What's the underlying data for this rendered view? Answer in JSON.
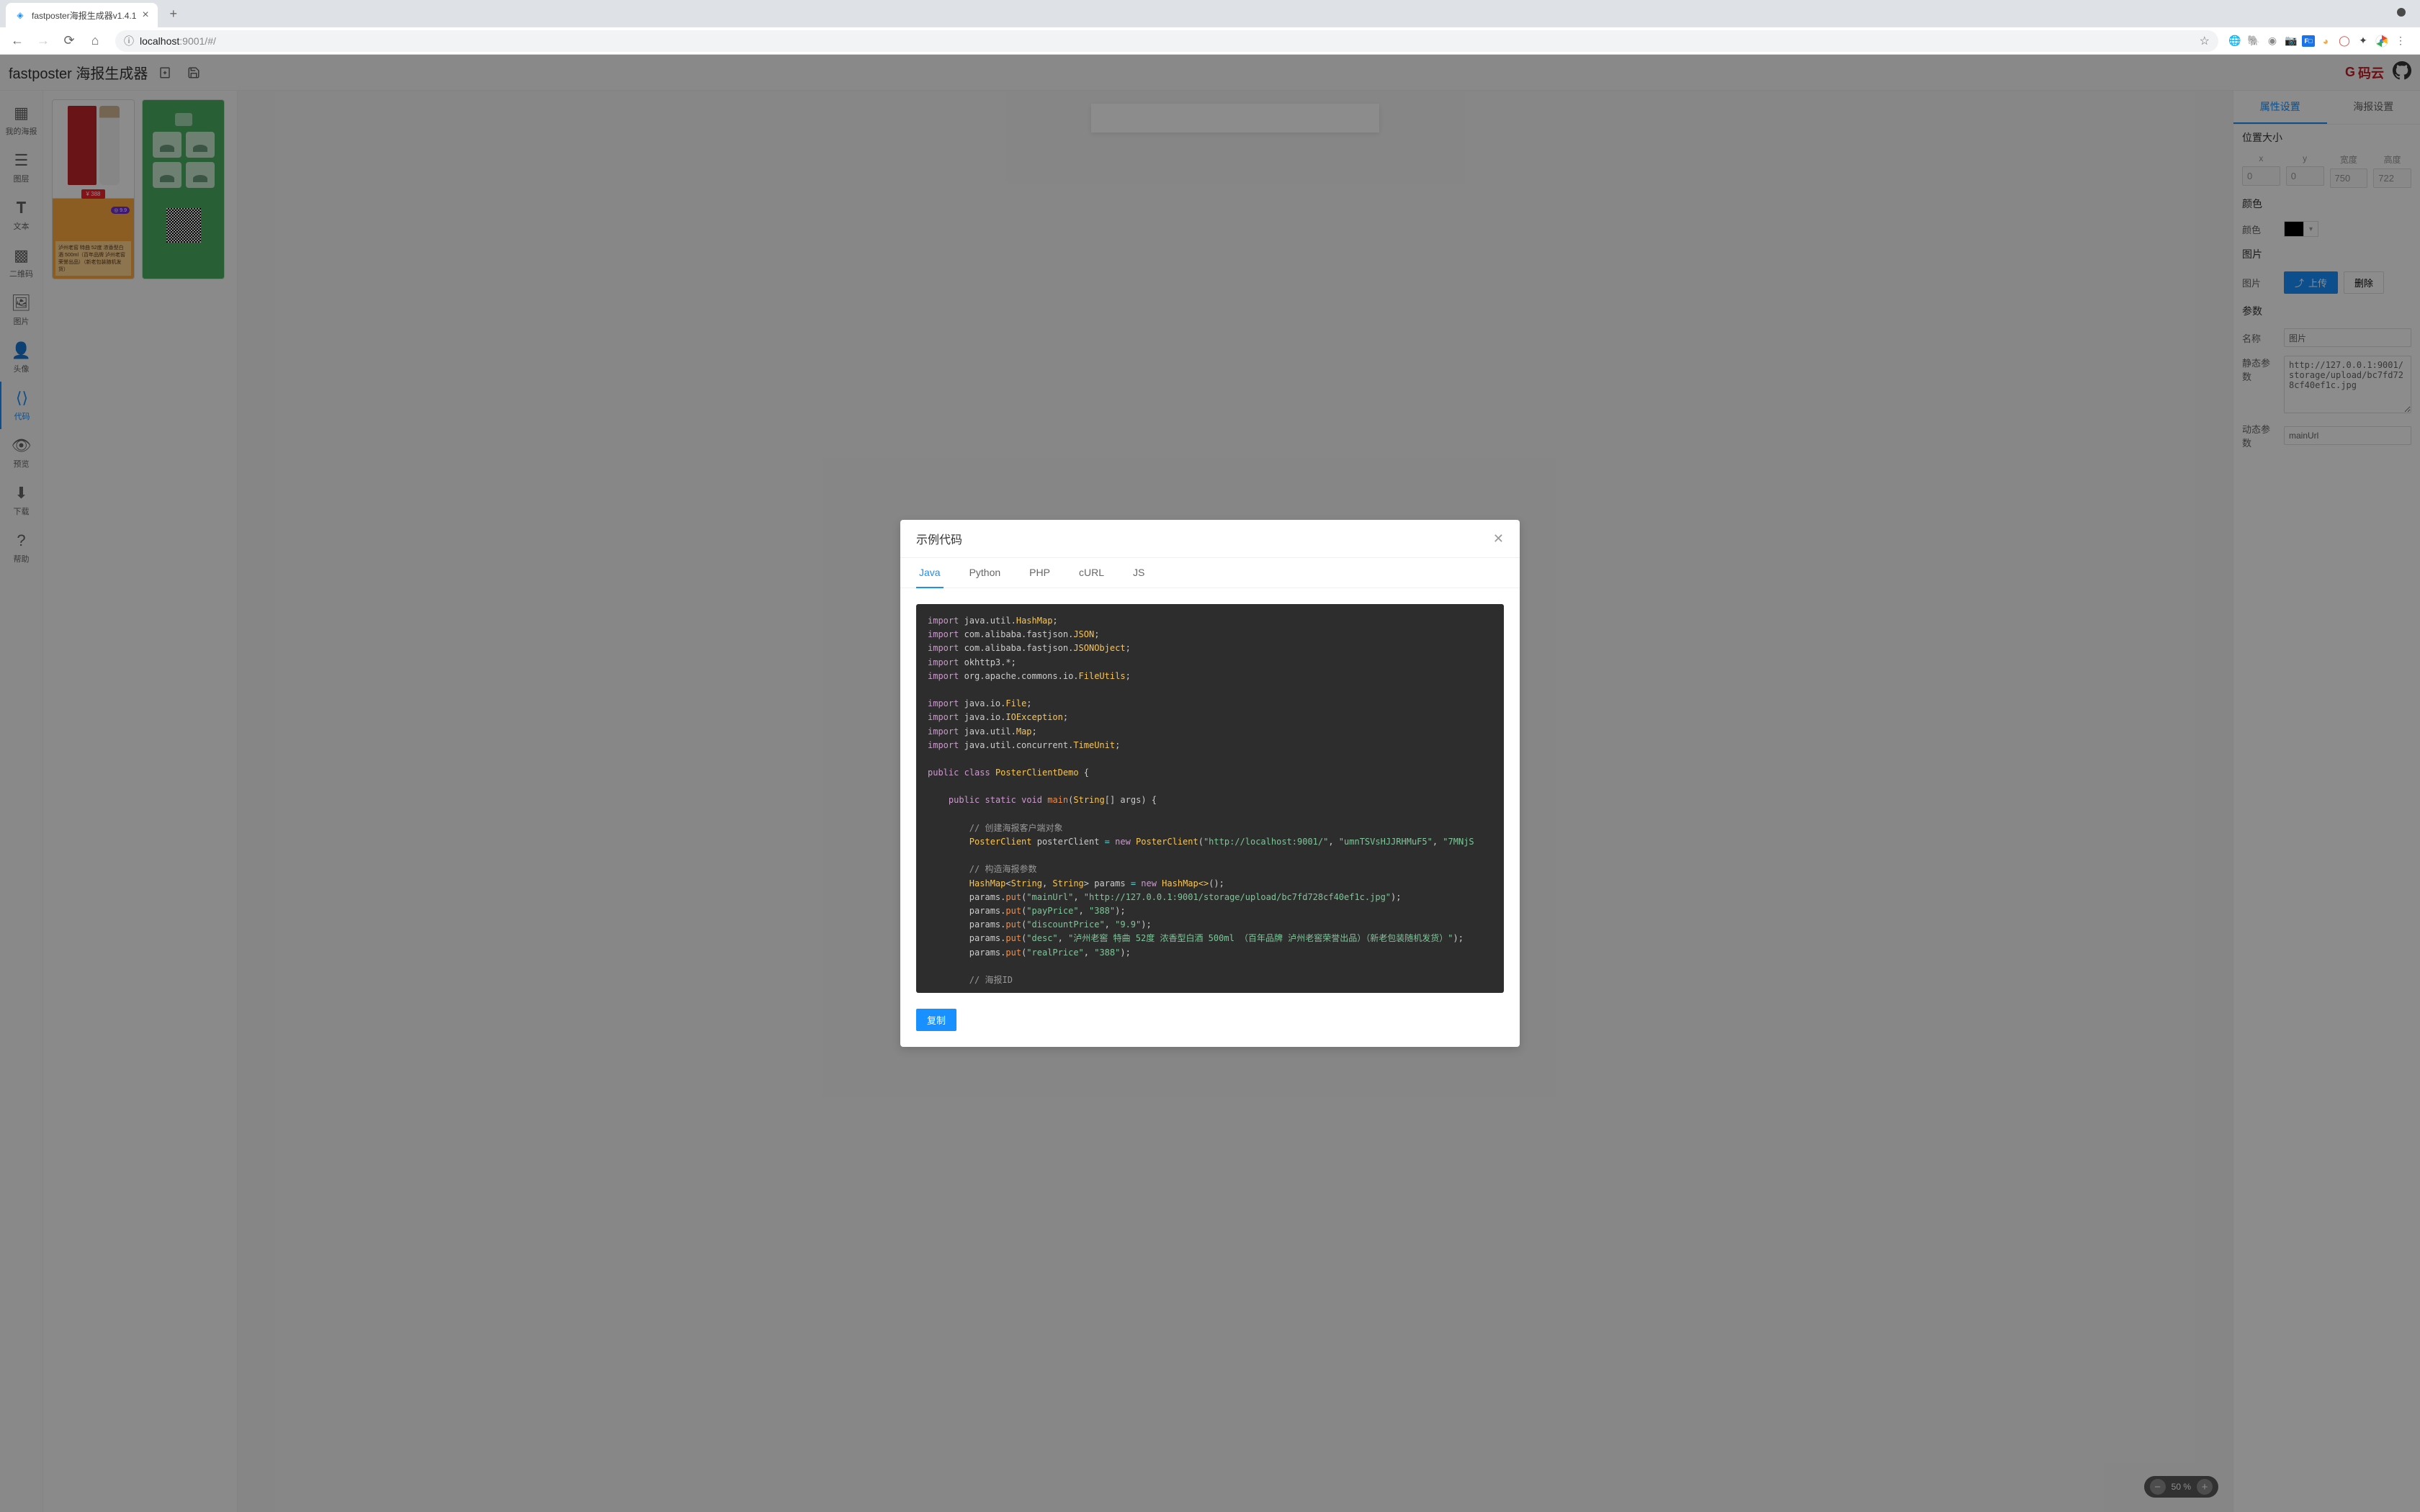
{
  "browser": {
    "tab_title": "fastposter海报生成器v1.4.1",
    "url_host": "localhost",
    "url_port_path": ":9001/#/"
  },
  "app": {
    "title": "fastposter 海报生成器",
    "gitee_label": "码云"
  },
  "sidebar_left": [
    "我的海报",
    "图层",
    "文本",
    "二维码",
    "图片",
    "头像",
    "代码",
    "预览",
    "下载",
    "帮助"
  ],
  "right_panel": {
    "tabs": [
      "属性设置",
      "海报设置"
    ],
    "section_position": "位置大小",
    "labels": {
      "x": "x",
      "y": "y",
      "width": "宽度",
      "height": "高度"
    },
    "values": {
      "x": "0",
      "y": "0",
      "width": "750",
      "height": "722"
    },
    "section_color": "颜色",
    "color_label": "颜色",
    "section_image": "图片",
    "image_label": "图片",
    "upload_btn": "上传",
    "delete_btn": "删除",
    "section_params": "参数",
    "name_label": "名称",
    "name_value": "图片",
    "static_label": "静态参数",
    "static_value": "http://127.0.0.1:9001/storage/upload/bc7fd728cf40ef1c.jpg",
    "dynamic_label": "动态参数",
    "dynamic_value": "mainUrl"
  },
  "zoom": {
    "level": "50 %"
  },
  "modal": {
    "title": "示例代码",
    "tabs": [
      "Java",
      "Python",
      "PHP",
      "cURL",
      "JS"
    ],
    "copy_btn": "复制"
  },
  "code": {
    "l1": {
      "kw": "import",
      "pkg": " java.util.",
      "cls": "HashMap",
      "end": ";"
    },
    "l2": {
      "kw": "import",
      "pkg": " com.alibaba.fastjson.",
      "cls": "JSON",
      "end": ";"
    },
    "l3": {
      "kw": "import",
      "pkg": " com.alibaba.fastjson.",
      "cls": "JSONObject",
      "end": ";"
    },
    "l4": {
      "kw": "import",
      "pkg": " okhttp3.*;"
    },
    "l5": {
      "kw": "import",
      "pkg": " org.apache.commons.io.",
      "cls": "FileUtils",
      "end": ";"
    },
    "l6": {
      "kw": "import",
      "pkg": " java.io.",
      "cls": "File",
      "end": ";"
    },
    "l7": {
      "kw": "import",
      "pkg": " java.io.",
      "cls": "IOException",
      "end": ";"
    },
    "l8": {
      "kw": "import",
      "pkg": " java.util.",
      "cls": "Map",
      "end": ";"
    },
    "l9": {
      "kw": "import",
      "pkg": " java.util.concurrent.",
      "cls": "TimeUnit",
      "end": ";"
    },
    "l10": {
      "kw1": "public",
      "kw2": "class",
      "cls": "PosterClientDemo",
      "brace": " {"
    },
    "l11": {
      "kw1": "public",
      "kw2": "static",
      "kw3": "void",
      "mth": "main",
      "paren": "(",
      "cls": "String",
      "arr": "[]",
      "arg": " args",
      "end": ") {"
    },
    "c1": "// 创建海报客户端对象",
    "l12": {
      "cls1": "PosterClient",
      "var": " posterClient ",
      "op": "=",
      "kw": " new ",
      "cls2": "PosterClient",
      "p": "(",
      "s1": "\"http://localhost:9001/\"",
      "c": ", ",
      "s2": "\"umnTSVsHJJRHMuF5\"",
      "c2": ", ",
      "s3": "\"7MNjS"
    },
    "c2": "// 构造海报参数",
    "l13": {
      "cls": "HashMap",
      "g": "<",
      "cls2": "String",
      "c": ", ",
      "cls3": "String",
      "ge": ">",
      "var": " params ",
      "op": "=",
      "kw": " new ",
      "ctor": "HashMap<>",
      "end": "();"
    },
    "l14": {
      "var": "params.",
      "mth": "put",
      "p": "(",
      "s1": "\"mainUrl\"",
      "c": ", ",
      "s2": "\"http://127.0.0.1:9001/storage/upload/bc7fd728cf40ef1c.jpg\"",
      "end": ");"
    },
    "l15": {
      "var": "params.",
      "mth": "put",
      "p": "(",
      "s1": "\"payPrice\"",
      "c": ", ",
      "s2": "\"388\"",
      "end": ");"
    },
    "l16": {
      "var": "params.",
      "mth": "put",
      "p": "(",
      "s1": "\"discountPrice\"",
      "c": ", ",
      "s2": "\"9.9\"",
      "end": ");"
    },
    "l17": {
      "var": "params.",
      "mth": "put",
      "p": "(",
      "s1": "\"desc\"",
      "c": ", ",
      "s2": "\"泸州老窖 特曲 52度 浓香型白酒 500ml （百年品牌 泸州老窖荣誉出品）（新老包装随机发货）\"",
      "end": ");"
    },
    "l18": {
      "var": "params.",
      "mth": "put",
      "p": "(",
      "s1": "\"realPrice\"",
      "c": ", ",
      "s2": "\"388\"",
      "end": ");"
    },
    "c3": "// 海报ID"
  }
}
